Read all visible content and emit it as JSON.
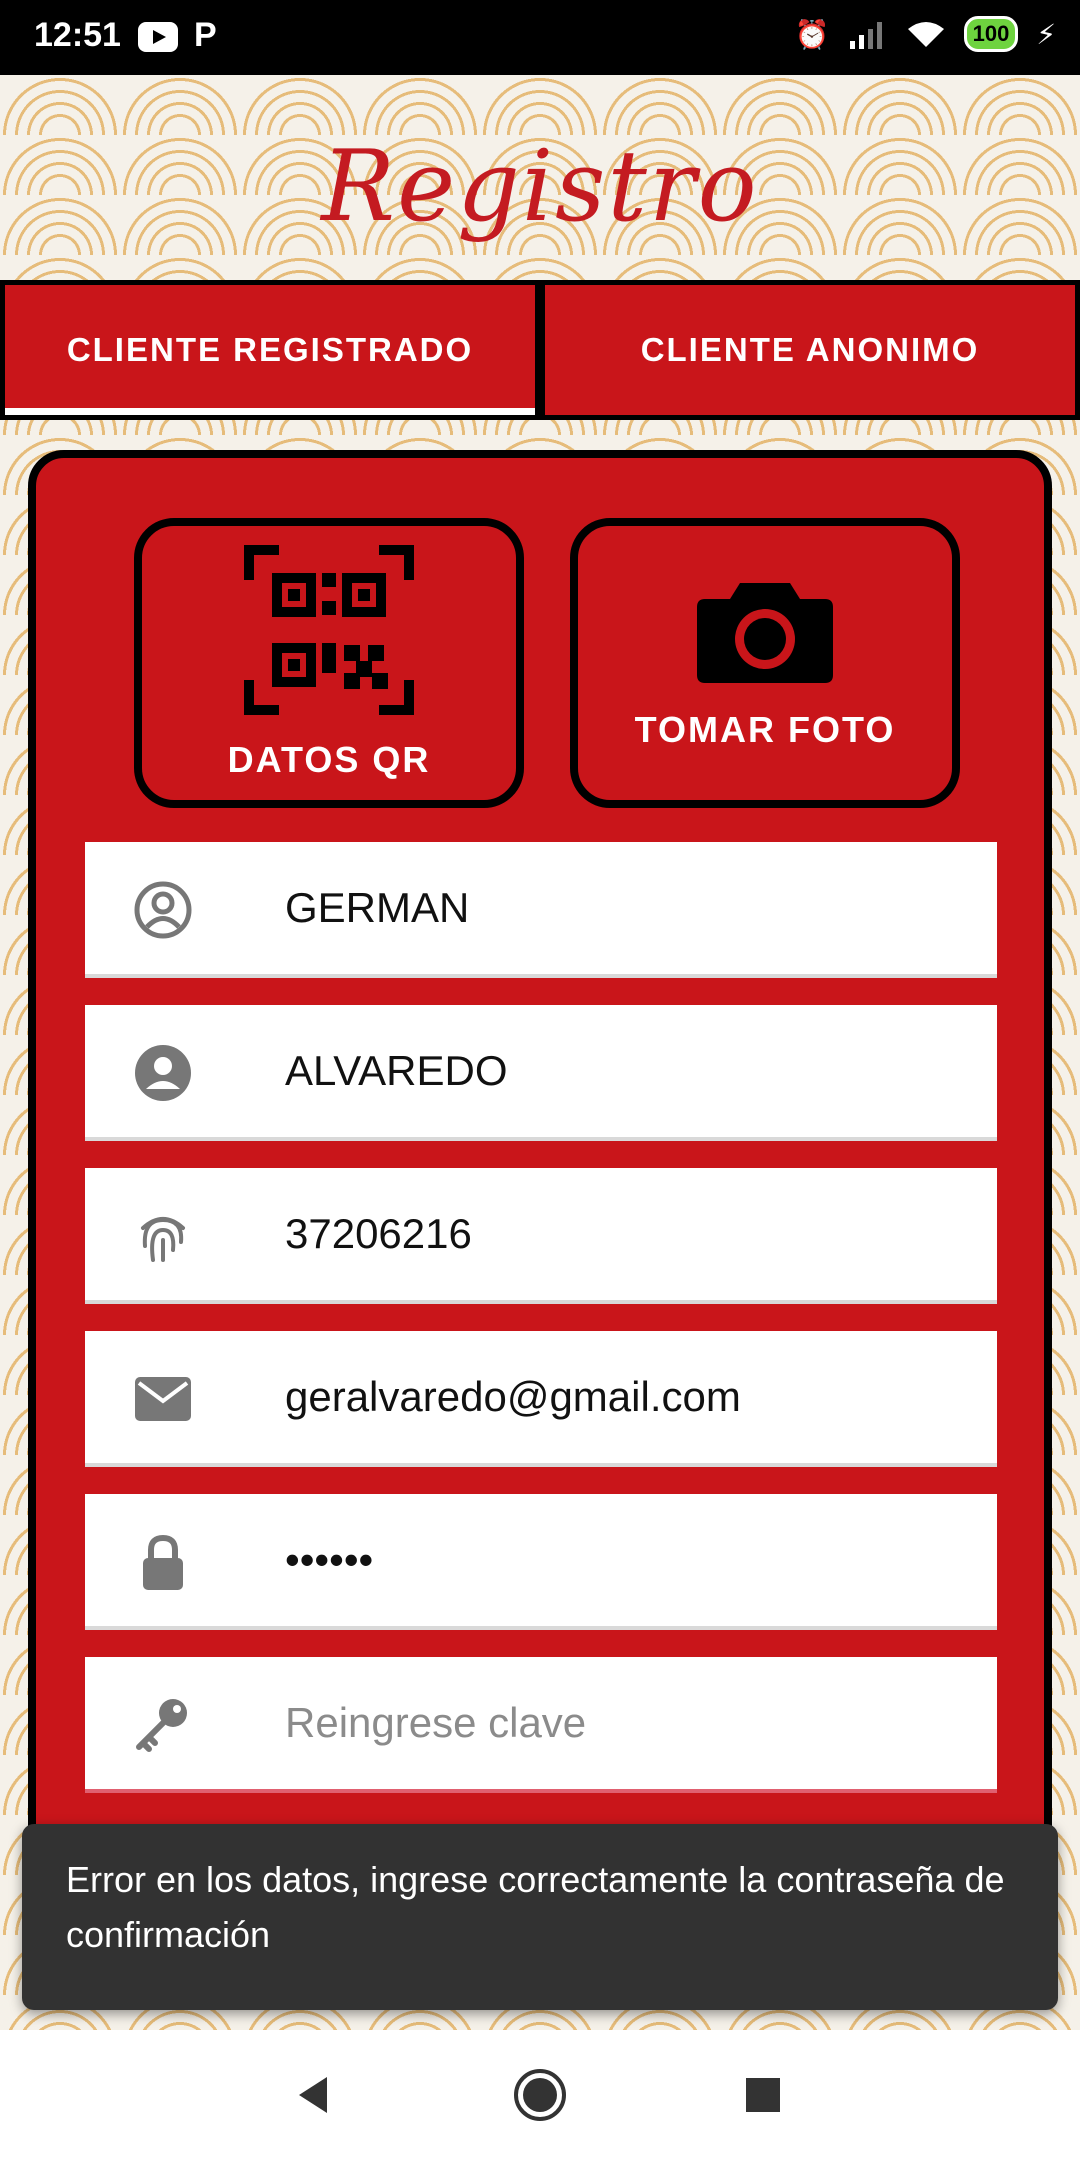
{
  "status_bar": {
    "time": "12:51",
    "p_icon": "P",
    "battery": "100"
  },
  "header": {
    "title": "Registro"
  },
  "tabs": [
    {
      "label": "CLIENTE REGISTRADO",
      "active": true
    },
    {
      "label": "CLIENTE ANONIMO",
      "active": false
    }
  ],
  "actions": {
    "qr_label": "DATOS QR",
    "photo_label": "TOMAR FOTO"
  },
  "form": {
    "first_name": "GERMAN",
    "last_name": "ALVAREDO",
    "dni": "37206216",
    "email": "geralvaredo@gmail.com",
    "password": "••••••",
    "confirm_placeholder": "Reingrese clave"
  },
  "snackbar": {
    "message": "Error en los datos, ingrese correctamente la contraseña de confirmación"
  },
  "colors": {
    "primary": "#c9151a",
    "title": "#c41b21",
    "snackbar": "#323232"
  }
}
